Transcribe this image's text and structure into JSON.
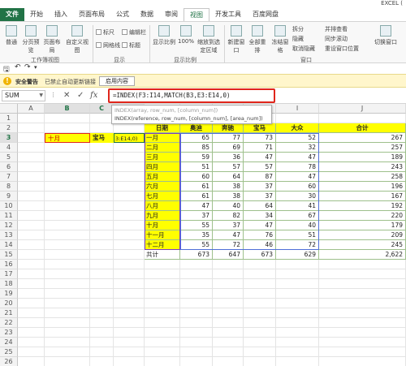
{
  "app": {
    "title": "EXCEL ("
  },
  "tabs": [
    "文件",
    "开始",
    "插入",
    "页面布局",
    "公式",
    "数据",
    "审阅",
    "视图",
    "开发工具",
    "百度网盘"
  ],
  "active_tab": "视图",
  "ribbon": {
    "workbook_views": {
      "label": "工作簿视图",
      "normal": "普通",
      "page_break": "分页预览",
      "page_layout": "页面布局",
      "custom": "自定义视图"
    },
    "show": {
      "label": "显示",
      "ruler": "标尺",
      "formula_bar": "编辑栏",
      "gridlines": "网格线",
      "headings": "标题"
    },
    "zoom": {
      "label": "显示比例",
      "zoom": "显示比例",
      "hundred": "100%",
      "zoom_selection": "缩放到选定区域"
    },
    "window": {
      "label": "窗口",
      "new_window": "新建窗口",
      "arrange_all": "全部重排",
      "freeze": "冻结窗格",
      "split": "拆分",
      "hide": "隐藏",
      "unhide": "取消隐藏",
      "side_by_side": "并排查看",
      "sync_scroll": "同步滚动",
      "reset_pos": "重设窗口位置",
      "switch": "切换窗口"
    }
  },
  "security": {
    "title": "安全警告",
    "message": "已禁止自动更新链接",
    "button": "启用内容"
  },
  "formula_bar": {
    "name_box": "SUM",
    "formula": "=INDEX(F3:I14,MATCH(B3,E3:E14,0)",
    "tooltip_line1": "INDEX(array, row_num, [column_num])",
    "tooltip_line2": "INDEX(reference, row_num, [column_num], [area_num])"
  },
  "columns": [
    "A",
    "B",
    "C",
    "D",
    "E",
    "F",
    "G",
    "H",
    "I",
    "J"
  ],
  "rows": [
    "1",
    "2",
    "3",
    "4",
    "5",
    "6",
    "7",
    "8",
    "9",
    "10",
    "11",
    "12",
    "13",
    "14",
    "15",
    "16",
    "17",
    "18",
    "19",
    "20",
    "21",
    "22",
    "23",
    "24",
    "25",
    "26"
  ],
  "lookup": {
    "b3": "十月",
    "c3": "宝马",
    "d3": "3:E14,0)"
  },
  "table": {
    "headers": [
      "日期",
      "奥迪",
      "奔驰",
      "宝马",
      "大众",
      "合计"
    ],
    "rows": [
      [
        "一月",
        "65",
        "77",
        "73",
        "52",
        "267"
      ],
      [
        "二月",
        "85",
        "69",
        "71",
        "32",
        "257"
      ],
      [
        "三月",
        "59",
        "36",
        "47",
        "47",
        "189"
      ],
      [
        "四月",
        "51",
        "57",
        "57",
        "78",
        "243"
      ],
      [
        "五月",
        "60",
        "64",
        "87",
        "47",
        "258"
      ],
      [
        "六月",
        "61",
        "38",
        "37",
        "60",
        "196"
      ],
      [
        "七月",
        "61",
        "38",
        "37",
        "30",
        "167"
      ],
      [
        "八月",
        "47",
        "40",
        "64",
        "41",
        "192"
      ],
      [
        "九月",
        "37",
        "82",
        "34",
        "67",
        "220"
      ],
      [
        "十月",
        "55",
        "37",
        "47",
        "40",
        "179"
      ],
      [
        "十一月",
        "35",
        "47",
        "76",
        "51",
        "209"
      ],
      [
        "十二月",
        "55",
        "72",
        "46",
        "72",
        "245"
      ]
    ],
    "total": [
      "共计",
      "673",
      "647",
      "673",
      "629",
      "2,622"
    ]
  },
  "colors": {
    "accent": "#217346",
    "yellow": "#ffff00",
    "red_box": "#e0261c",
    "blue_sel": "#4f6fd8",
    "purple_sel": "#7b3fbf"
  }
}
